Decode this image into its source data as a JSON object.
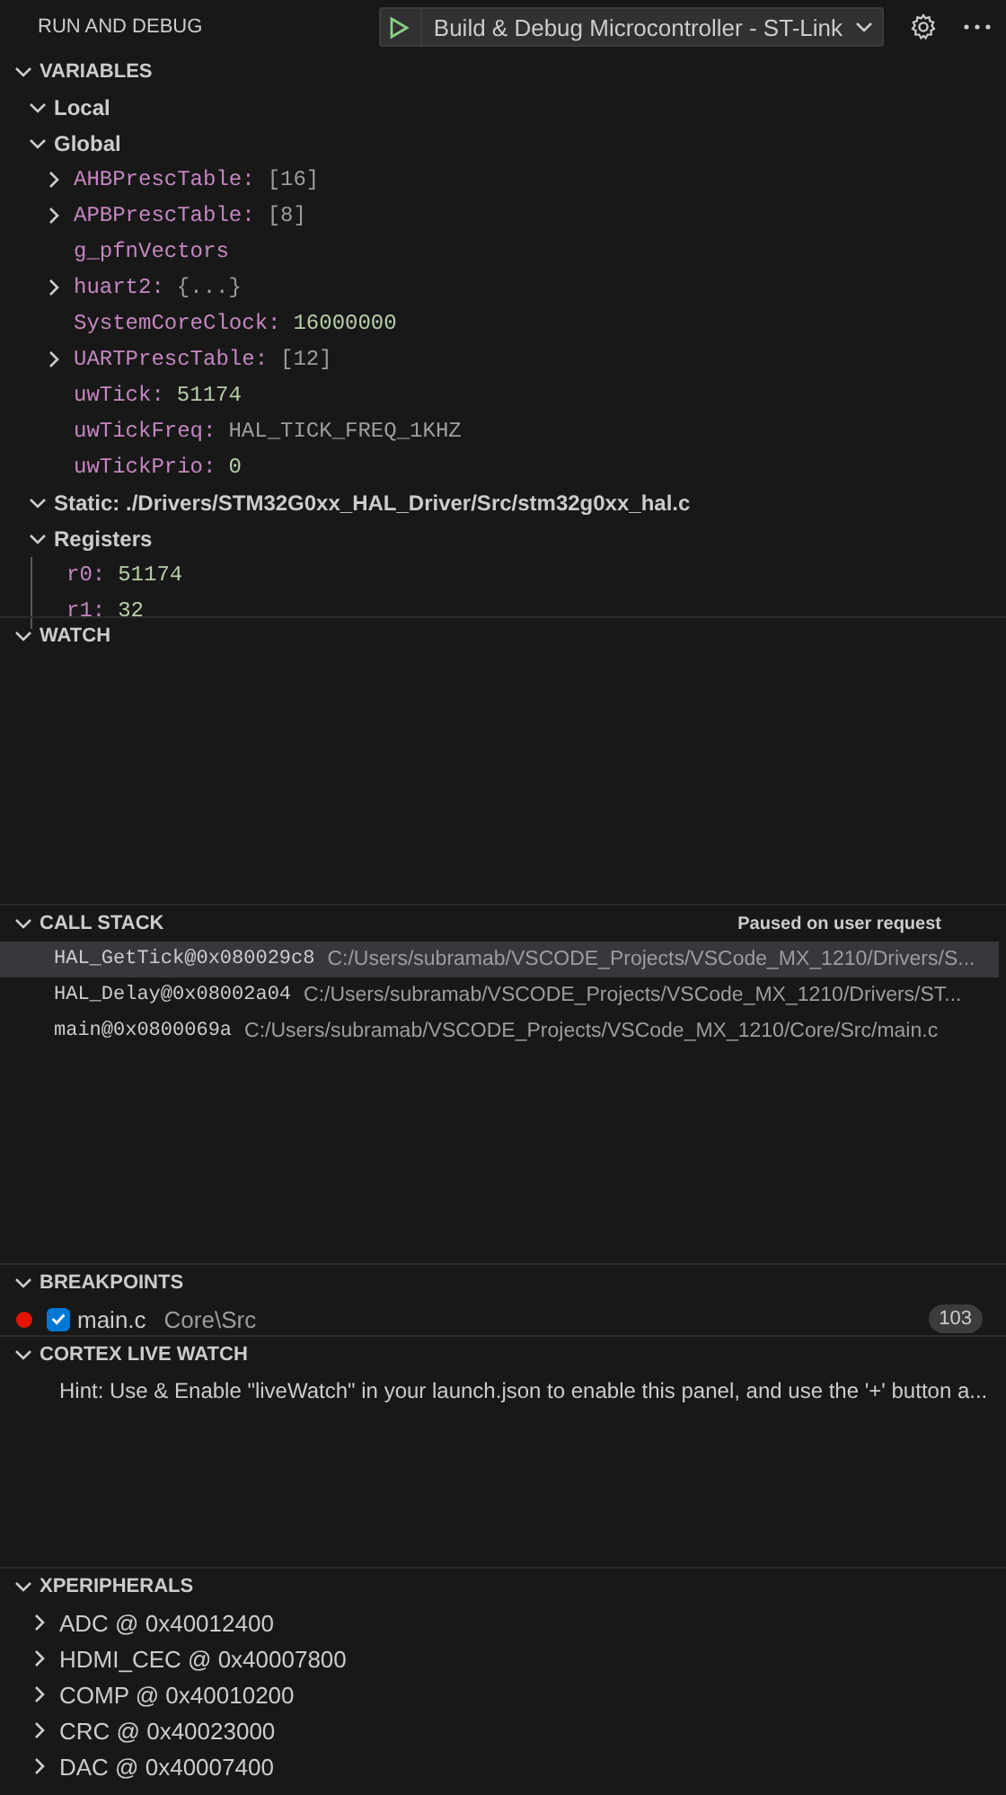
{
  "header": {
    "title": "RUN AND DEBUG",
    "config": "Build & Debug Microcontroller - ST-Link"
  },
  "variables": {
    "title": "VARIABLES",
    "expanded": true,
    "scopes": [
      {
        "label": "Local",
        "expanded": true,
        "kind": "plain"
      },
      {
        "label": "Global",
        "expanded": true,
        "kind": "plain",
        "children": [
          {
            "name": "AHBPrescTable:",
            "value": "[16]",
            "numeric": false,
            "expandable": true
          },
          {
            "name": "APBPrescTable:",
            "value": "[8]",
            "numeric": false,
            "expandable": true
          },
          {
            "name": "g_pfnVectors",
            "expandable": false
          },
          {
            "name": "huart2:",
            "value": "{...}",
            "numeric": false,
            "expandable": true
          },
          {
            "name": "SystemCoreClock:",
            "value": "16000000",
            "numeric": true,
            "expandable": false
          },
          {
            "name": "UARTPrescTable:",
            "value": "[12]",
            "numeric": false,
            "expandable": true
          },
          {
            "name": "uwTick:",
            "value": "51174",
            "numeric": true,
            "expandable": false
          },
          {
            "name": "uwTickFreq:",
            "value": "HAL_TICK_FREQ_1KHZ",
            "numeric": false,
            "expandable": false
          },
          {
            "name": "uwTickPrio:",
            "value": "0",
            "numeric": true,
            "expandable": false
          }
        ]
      },
      {
        "label": "Static: ./Drivers/STM32G0xx_HAL_Driver/Src/stm32g0xx_hal.c",
        "expanded": true,
        "kind": "plain"
      },
      {
        "label": "Registers",
        "expanded": true,
        "kind": "guided",
        "children": [
          {
            "name": "r0:",
            "value": "51174",
            "numeric": true,
            "expandable": false
          },
          {
            "name": "r1:",
            "value": "32",
            "numeric": true,
            "expandable": false
          }
        ]
      }
    ]
  },
  "watch": {
    "title": "WATCH",
    "expanded": true
  },
  "call_stack": {
    "title": "CALL STACK",
    "expanded": true,
    "status": "Paused on user request",
    "frames": [
      {
        "name": "HAL_GetTick@0x080029c8",
        "path": "C:/Users/subramab/VSCODE_Projects/VSCode_MX_1210/Drivers/S...",
        "selected": true
      },
      {
        "name": "HAL_Delay@0x08002a04",
        "path": "C:/Users/subramab/VSCODE_Projects/VSCode_MX_1210/Drivers/ST...",
        "selected": false
      },
      {
        "name": "main@0x0800069a",
        "path": "C:/Users/subramab/VSCODE_Projects/VSCode_MX_1210/Core/Src/main.c",
        "selected": false
      }
    ]
  },
  "breakpoints": {
    "title": "BREAKPOINTS",
    "expanded": true,
    "items": [
      {
        "file": "main.c",
        "folder": "Core\\Src",
        "line": "103",
        "checked": true
      }
    ]
  },
  "live_watch": {
    "title": "CORTEX LIVE WATCH",
    "expanded": true,
    "hint": "Hint: Use & Enable \"liveWatch\" in your launch.json to enable this panel, and use the '+' button a..."
  },
  "peripherals": {
    "title": "XPERIPHERALS",
    "expanded": true,
    "items": [
      {
        "label": "ADC @ 0x40012400",
        "expanded": false
      },
      {
        "label": "HDMI_CEC @ 0x40007800",
        "expanded": false
      },
      {
        "label": "COMP @ 0x40010200",
        "expanded": false
      },
      {
        "label": "CRC @ 0x40023000",
        "expanded": false
      },
      {
        "label": "DAC @ 0x40007400",
        "expanded": false
      }
    ]
  }
}
